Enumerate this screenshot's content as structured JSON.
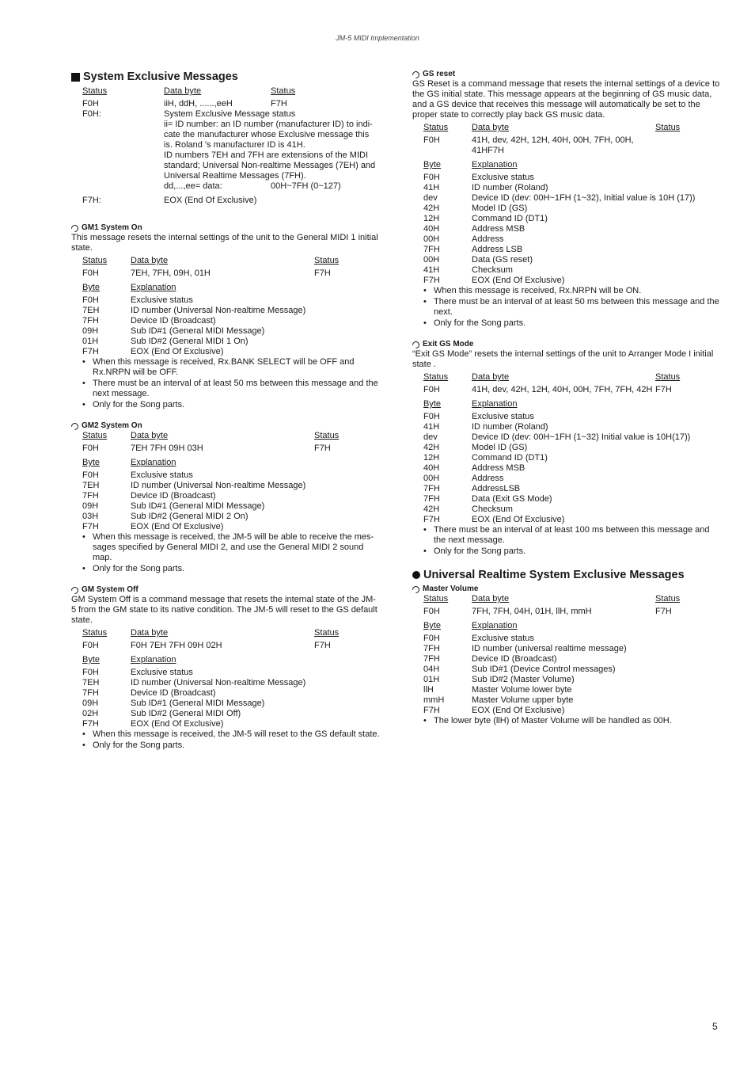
{
  "running_head": "JM-5 MIDI Implementation",
  "page_number": "5",
  "left_column": {
    "main_heading": "System Exclusive Messages",
    "sysex_table": {
      "headers": [
        "Status",
        "Data byte",
        "Status"
      ],
      "row": [
        "F0H",
        "iiH, ddH, ......,eeH",
        "F7H"
      ],
      "f0_label": "F0H:",
      "f0_lines": [
        "System Exclusive Message status",
        "ii= ID number: an ID number (manufacturer ID) to indi-",
        "cate the manufacturer whose Exclusive message this",
        "is. Roland 's manufacturer ID is 41H.",
        "ID numbers 7EH and 7FH are extensions of the MIDI",
        "standard; Universal Non-realtime Messages (7EH) and",
        "Universal Realtime Messages (7FH)."
      ],
      "dd_label": "dd,...,ee= data:",
      "dd_value": "00H~7FH (0~127)",
      "f7_label": "F7H:",
      "f7_value": "EOX (End Of Exclusive)"
    },
    "gm1": {
      "title": "GM1 System On",
      "description": "This message resets the internal settings of the unit to the General MIDI 1 initial state.",
      "headers": [
        "Status",
        "Data byte",
        "Status"
      ],
      "row": [
        "F0H",
        "7EH, 7FH, 09H, 01H",
        "F7H"
      ],
      "byte_headers": [
        "Byte",
        "Explanation"
      ],
      "bytes": [
        [
          "F0H",
          "Exclusive status"
        ],
        [
          "7EH",
          "ID number (Universal Non-realtime Message)"
        ],
        [
          "7FH",
          "Device ID (Broadcast)"
        ],
        [
          "09H",
          "Sub ID#1 (General MIDI Message)"
        ],
        [
          "01H",
          "Sub ID#2 (General MIDI 1 On)"
        ],
        [
          "F7H",
          "EOX (End Of Exclusive)"
        ]
      ],
      "notes": [
        "When this message is received, Rx.BANK SELECT will be OFF and Rx.NRPN will be OFF.",
        "There must be an interval of at least 50 ms between this message and the next message.",
        "Only for the Song parts."
      ]
    },
    "gm2": {
      "title": "GM2 System On",
      "headers": [
        "Status",
        "Data byte",
        "Status"
      ],
      "row": [
        "F0H",
        "7EH 7FH 09H 03H",
        "F7H"
      ],
      "byte_headers": [
        "Byte",
        "Explanation"
      ],
      "bytes": [
        [
          "F0H",
          "Exclusive status"
        ],
        [
          "7EH",
          "ID number (Universal Non-realtime Message)"
        ],
        [
          "7FH",
          "Device ID (Broadcast)"
        ],
        [
          "09H",
          "Sub ID#1 (General MIDI Message)"
        ],
        [
          "03H",
          "Sub ID#2 (General MIDI 2 On)"
        ],
        [
          "F7H",
          "EOX (End Of Exclusive)"
        ]
      ],
      "notes": [
        "When this message is received, the JM-5 will be able to receive the mes-sages specified by General MIDI 2, and use the General MIDI 2 sound map.",
        "Only for the Song parts."
      ]
    },
    "gm_off": {
      "title": "GM System Off",
      "description": "GM System Off is a command message that resets the internal state of the JM-5 from the GM state to its native condition. The JM-5 will reset to the GS default state.",
      "headers": [
        "Status",
        "Data byte",
        "Status"
      ],
      "row": [
        "F0H",
        "F0H 7EH 7FH 09H 02H",
        "F7H"
      ],
      "byte_headers": [
        "Byte",
        "Explanation"
      ],
      "bytes": [
        [
          "F0H",
          "Exclusive status"
        ],
        [
          "7EH",
          "ID number (Universal Non-realtime Message)"
        ],
        [
          "7FH",
          "Device ID (Broadcast)"
        ],
        [
          "09H",
          "Sub ID#1 (General MIDI Message)"
        ],
        [
          "02H",
          "Sub ID#2 (General MIDI Off)"
        ],
        [
          "F7H",
          "EOX (End Of Exclusive)"
        ]
      ],
      "notes": [
        "When this message is received, the JM-5 will reset to the GS default state.",
        "Only for the Song parts."
      ]
    }
  },
  "right_column": {
    "gs_reset": {
      "title": "GS reset",
      "description": "GS Reset is a command message that resets the internal settings of a device to the GS initial state. This message appears at the beginning of GS music data, and a GS device that receives this message will automatically be set to the proper state to correctly play back GS music data.",
      "headers": [
        "Status",
        "Data byte",
        "Status"
      ],
      "row": [
        "F0H",
        "41H, dev, 42H, 12H, 40H, 00H, 7FH, 00H, 41HF7H",
        ""
      ],
      "byte_headers": [
        "Byte",
        "Explanation"
      ],
      "bytes": [
        [
          "F0H",
          "Exclusive status"
        ],
        [
          "41H",
          "ID number (Roland)"
        ],
        [
          "dev",
          "Device ID (dev: 00H~1FH (1~32), Initial value is 10H (17))"
        ],
        [
          "42H",
          "Model ID (GS)"
        ],
        [
          "12H",
          "Command ID (DT1)"
        ],
        [
          "40H",
          "Address MSB"
        ],
        [
          "00H",
          "Address"
        ],
        [
          "7FH",
          "Address LSB"
        ],
        [
          "00H",
          "Data (GS reset)"
        ],
        [
          "41H",
          "Checksum"
        ],
        [
          "F7H",
          "EOX (End Of Exclusive)"
        ]
      ],
      "notes": [
        "When this message is received, Rx.NRPN will be ON.",
        "There must be an interval of at least 50 ms between this message and the next.",
        "Only for the Song parts."
      ]
    },
    "exit_gs": {
      "title": "Exit GS Mode",
      "description": "“Exit GS Mode” resets the internal settings of the unit to Arranger Mode I initial state .",
      "headers": [
        "Status",
        "Data byte",
        "Status"
      ],
      "row": [
        "F0H",
        "41H, dev, 42H, 12H, 40H, 00H, 7FH, 7FH, 42H",
        "F7H"
      ],
      "byte_headers": [
        "Byte",
        "Explanation"
      ],
      "bytes": [
        [
          "F0H",
          "Exclusive status"
        ],
        [
          "41H",
          "ID number (Roland)"
        ],
        [
          "dev",
          "Device ID (dev: 00H~1FH (1~32) Initial value is 10H(17))"
        ],
        [
          "42H",
          "Model ID (GS)"
        ],
        [
          "12H",
          "Command ID (DT1)"
        ],
        [
          "40H",
          "Address MSB"
        ],
        [
          "00H",
          "Address"
        ],
        [
          "7FH",
          "AddressLSB"
        ],
        [
          "7FH",
          "Data (Exit GS Mode)"
        ],
        [
          "42H",
          "Checksum"
        ],
        [
          "F7H",
          "EOX (End Of Exclusive)"
        ]
      ],
      "notes": [
        "There must be an interval of at least 100 ms between this message and the next message.",
        "Only for the Song parts."
      ]
    },
    "universal_heading": "Universal Realtime System Exclusive Messages",
    "master_volume": {
      "title": "Master Volume",
      "headers": [
        "Status",
        "Data byte",
        "Status"
      ],
      "row": [
        "F0H",
        "7FH, 7FH, 04H, 01H, llH, mmH",
        "F7H"
      ],
      "byte_headers": [
        "Byte",
        "Explanation"
      ],
      "bytes": [
        [
          "F0H",
          "Exclusive status"
        ],
        [
          "7FH",
          "ID number (universal realtime message)"
        ],
        [
          "7FH",
          "Device ID (Broadcast)"
        ],
        [
          "04H",
          "Sub ID#1 (Device Control messages)"
        ],
        [
          "01H",
          "Sub ID#2 (Master Volume)"
        ],
        [
          "llH",
          "Master Volume lower byte"
        ],
        [
          "mmH",
          "Master Volume upper byte"
        ],
        [
          "F7H",
          "EOX (End Of Exclusive)"
        ]
      ],
      "notes": [
        "The lower byte (llH) of Master Volume will be handled as 00H."
      ]
    }
  }
}
